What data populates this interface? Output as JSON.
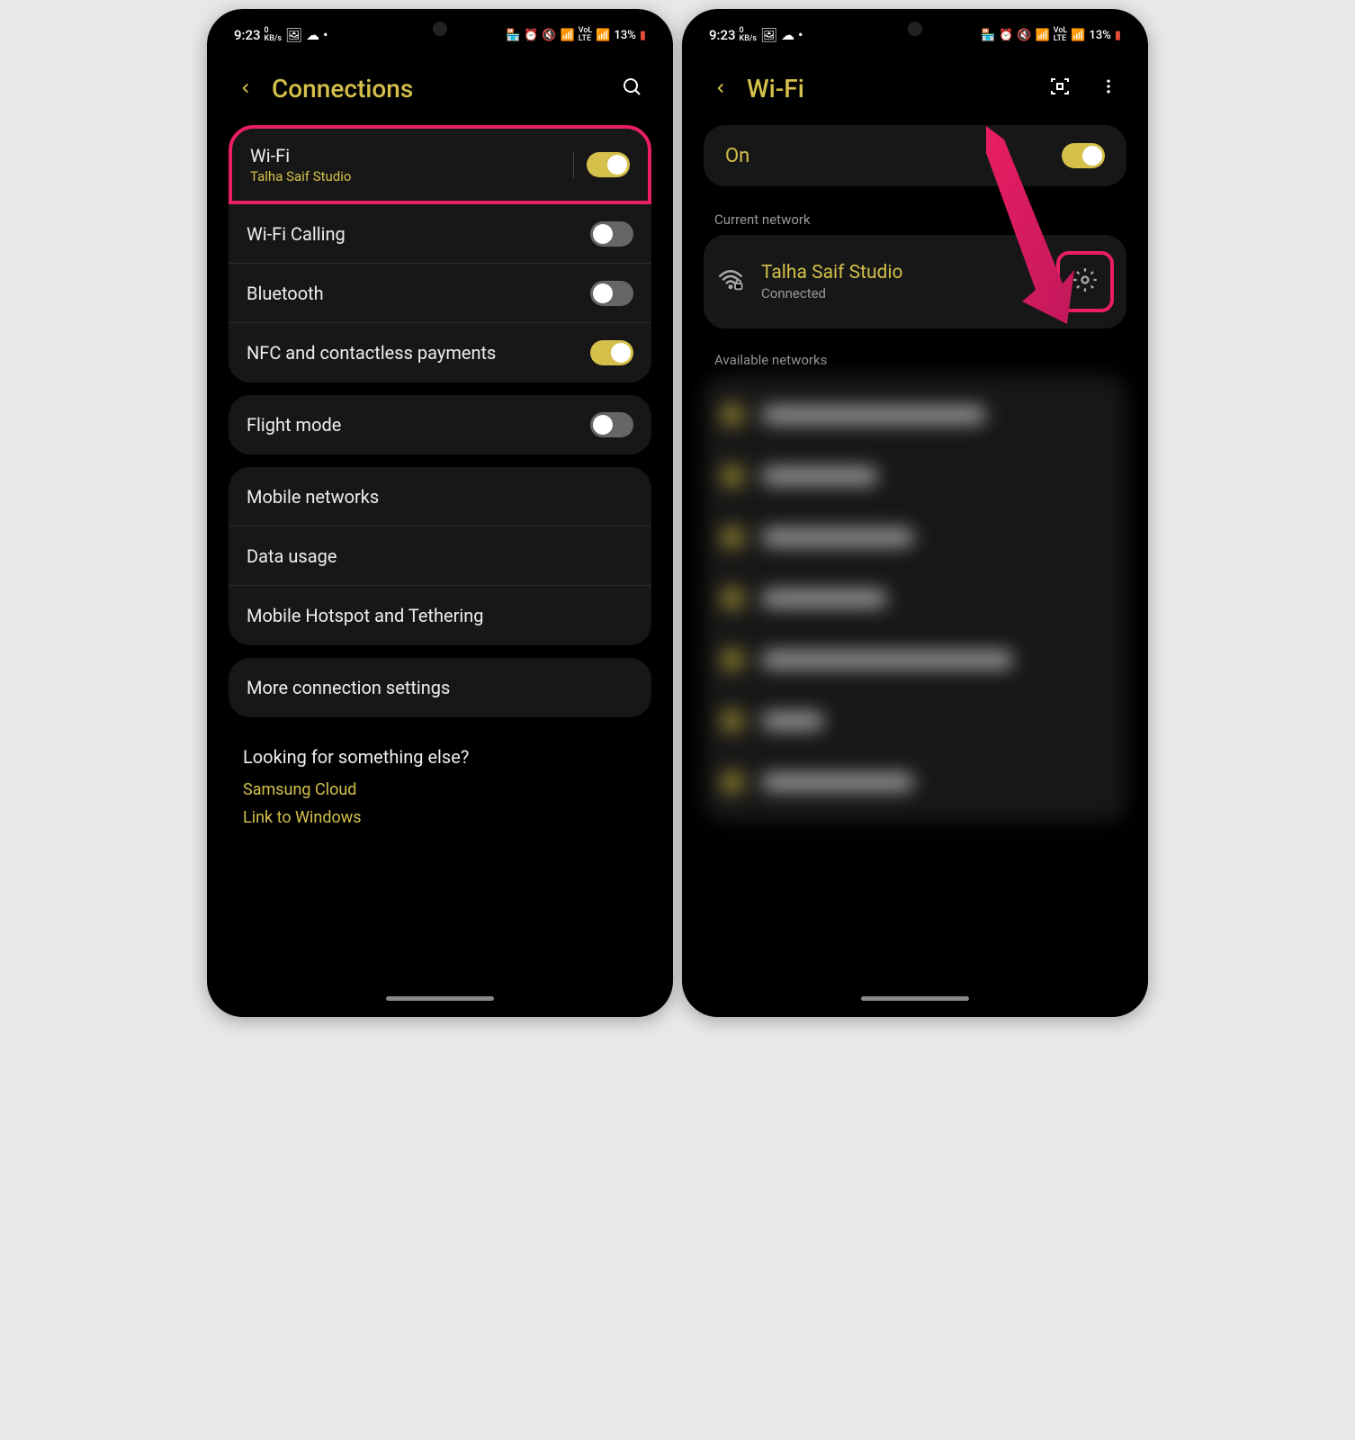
{
  "status": {
    "time": "9:23",
    "speed": "0",
    "speed_unit": "KB/s",
    "battery": "13%"
  },
  "screen1": {
    "title": "Connections",
    "rows": {
      "wifi": {
        "label": "Wi-Fi",
        "sub": "Talha Saif Studio",
        "on": true
      },
      "wifi_calling": {
        "label": "Wi-Fi Calling",
        "on": false
      },
      "bluetooth": {
        "label": "Bluetooth",
        "on": false
      },
      "nfc": {
        "label": "NFC and contactless payments",
        "on": true
      },
      "flight": {
        "label": "Flight mode",
        "on": false
      },
      "mobile_networks": {
        "label": "Mobile networks"
      },
      "data_usage": {
        "label": "Data usage"
      },
      "hotspot": {
        "label": "Mobile Hotspot and Tethering"
      },
      "more": {
        "label": "More connection settings"
      }
    },
    "footer": {
      "heading": "Looking for something else?",
      "links": [
        "Samsung Cloud",
        "Link to Windows"
      ]
    }
  },
  "screen2": {
    "title": "Wi-Fi",
    "on_label": "On",
    "current_label": "Current network",
    "current": {
      "name": "Talha Saif Studio",
      "status": "Connected"
    },
    "available_label": "Available networks"
  }
}
